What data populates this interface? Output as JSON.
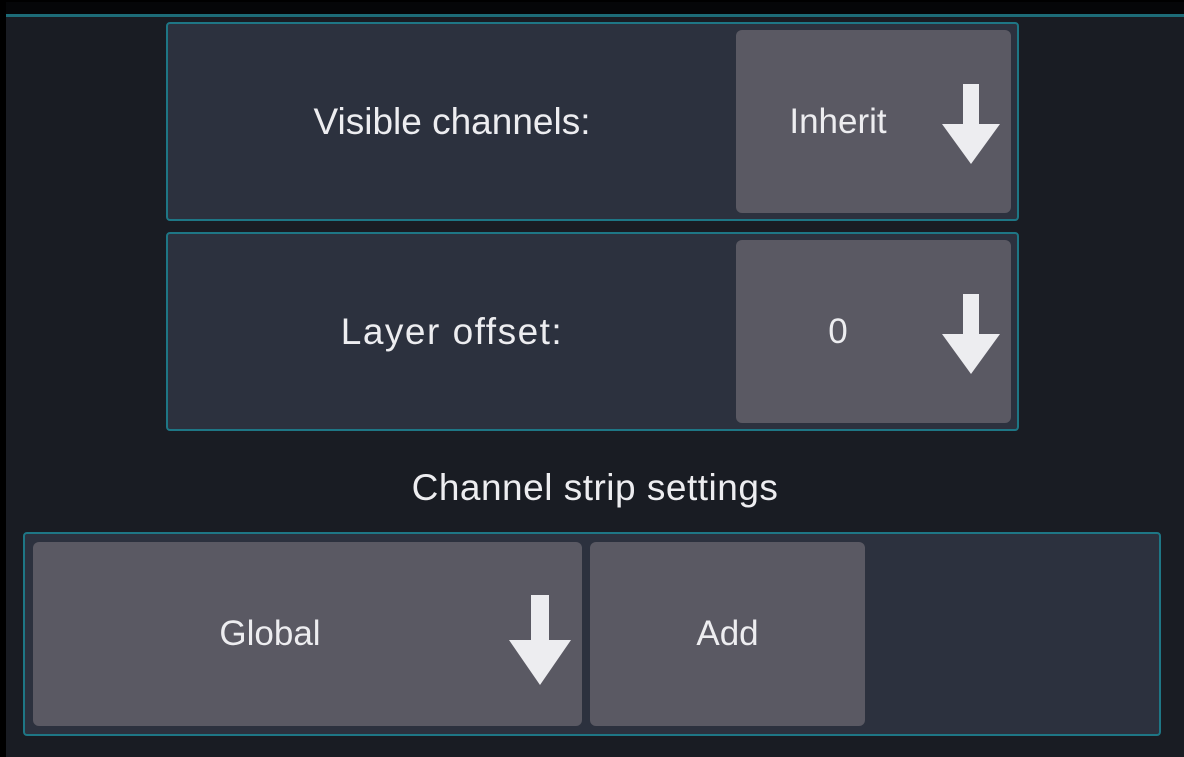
{
  "colors": {
    "background": "#191c23",
    "panel": "#2c313e",
    "border": "#1e7685",
    "control": "#5a5963",
    "text": "#ededf0"
  },
  "visible_channels": {
    "label": "Visible channels:",
    "value": "Inherit",
    "icon": "arrow-down-icon"
  },
  "layer_offset": {
    "label": "Layer offset:",
    "value": "0",
    "icon": "arrow-down-icon"
  },
  "channel_strip": {
    "title": "Channel strip settings",
    "preset": {
      "value": "Global",
      "icon": "arrow-down-icon"
    },
    "add_label": "Add"
  }
}
